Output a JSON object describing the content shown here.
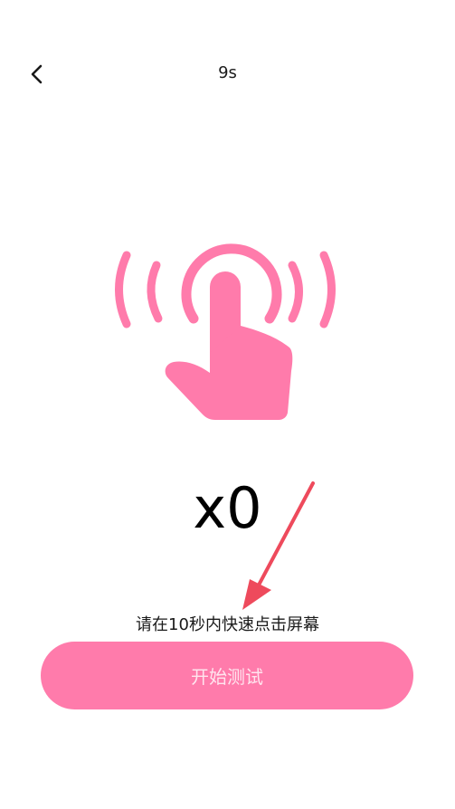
{
  "header": {
    "back_icon": "chevron-left-icon",
    "timer": "9s"
  },
  "illustration": {
    "icon": "tap-hand-icon",
    "color": "#ff7bab"
  },
  "counter": {
    "value": "x0"
  },
  "annotation": {
    "icon": "arrow-icon",
    "color": "#ee4a5c"
  },
  "instruction": {
    "text": "请在10秒内快速点击屏幕"
  },
  "start_button": {
    "label": "开始测试",
    "background": "#ff7bab",
    "text_color": "#ffe4ee"
  },
  "colors": {
    "background": "#ffffff",
    "accent": "#ff7bab"
  }
}
